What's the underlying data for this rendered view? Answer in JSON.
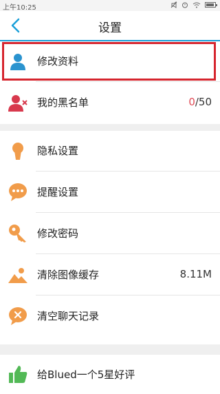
{
  "status": {
    "time": "上午10:25"
  },
  "header": {
    "title": "设置",
    "back_icon": "chevron-left-icon"
  },
  "group1": {
    "edit_profile": "修改资料",
    "blacklist": "我的黑名单",
    "blacklist_count": "0",
    "blacklist_total": "/50"
  },
  "group2": {
    "privacy": "隐私设置",
    "notify": "提醒设置",
    "password": "修改密码",
    "clear_cache": "清除图像缓存",
    "cache_size": "8.11M",
    "clear_chat": "清空聊天记录"
  },
  "group3": {
    "rate": "给Blued一个5星好评"
  },
  "colors": {
    "accent": "#1a9fd8",
    "icon_orange": "#f19c4a",
    "icon_red": "#d8394d",
    "icon_green": "#52b956",
    "icon_blue": "#2a93cf",
    "highlight": "#d6252e"
  }
}
